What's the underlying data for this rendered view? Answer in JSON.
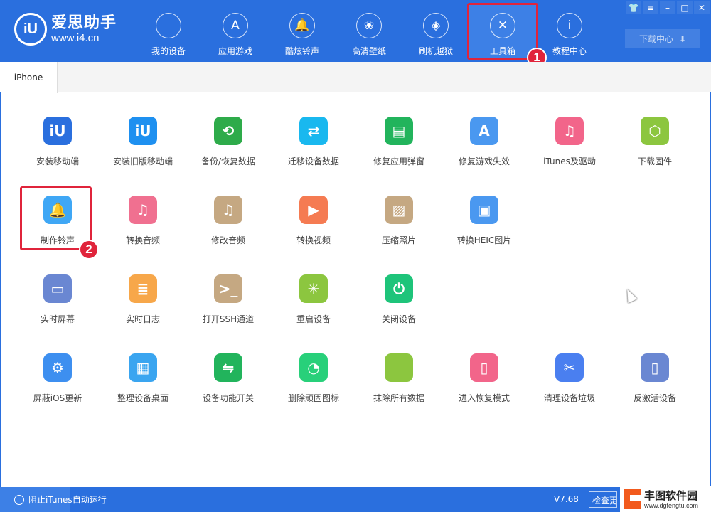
{
  "app": {
    "logo_mark": "iU",
    "name": "爱思助手",
    "url": "www.i4.cn"
  },
  "nav": [
    {
      "label": "我的设备",
      "icon": "apple-icon",
      "glyph": ""
    },
    {
      "label": "应用游戏",
      "icon": "app-store-icon",
      "glyph": "A"
    },
    {
      "label": "酷炫铃声",
      "icon": "bell-icon",
      "glyph": "🔔"
    },
    {
      "label": "高清壁纸",
      "icon": "flower-icon",
      "glyph": "❀"
    },
    {
      "label": "刷机越狱",
      "icon": "dropbox-icon",
      "glyph": "◈"
    },
    {
      "label": "工具箱",
      "icon": "tools-icon",
      "glyph": "✕",
      "active": true
    },
    {
      "label": "教程中心",
      "icon": "info-icon",
      "glyph": "i"
    }
  ],
  "window_controls": [
    "shirt-icon",
    "menu-icon",
    "minimize-icon",
    "maximize-icon",
    "close-icon"
  ],
  "window_glyphs": [
    "👕",
    "≡",
    "–",
    "□",
    "✕"
  ],
  "download_center": {
    "label": "下载中心",
    "icon": "download-icon"
  },
  "tabs": [
    {
      "label": "iPhone"
    }
  ],
  "badges": {
    "one": "1",
    "two": "2"
  },
  "rows": [
    [
      {
        "label": "安装移动端",
        "color": "#2a6fde",
        "glyph": "iU"
      },
      {
        "label": "安装旧版移动端",
        "color": "#1e90f0",
        "glyph": "iU"
      },
      {
        "label": "备份/恢复数据",
        "color": "#2eab4a",
        "glyph": "⟲"
      },
      {
        "label": "迁移设备数据",
        "color": "#19b8ef",
        "glyph": "⇄"
      },
      {
        "label": "修复应用弹窗",
        "color": "#22b45c",
        "glyph": "▤"
      },
      {
        "label": "修复游戏失效",
        "color": "#4a98f0",
        "glyph": "A"
      },
      {
        "label": "iTunes及驱动",
        "color": "#f2658a",
        "glyph": "♫"
      },
      {
        "label": "下载固件",
        "color": "#8cc63f",
        "glyph": "⬡"
      }
    ],
    [
      {
        "label": "制作铃声",
        "color": "#3fa7f5",
        "glyph": "🔔"
      },
      {
        "label": "转换音频",
        "color": "#f07090",
        "glyph": "♫"
      },
      {
        "label": "修改音频",
        "color": "#c5a882",
        "glyph": "♫"
      },
      {
        "label": "转换视频",
        "color": "#f57b52",
        "glyph": "▶"
      },
      {
        "label": "压缩照片",
        "color": "#c5a882",
        "glyph": "▨"
      },
      {
        "label": "转换HEIC图片",
        "color": "#4a98f0",
        "glyph": "▣"
      }
    ],
    [
      {
        "label": "实时屏幕",
        "color": "#6a87d2",
        "glyph": "▭"
      },
      {
        "label": "实时日志",
        "color": "#f7a74a",
        "glyph": "≣"
      },
      {
        "label": "打开SSH通道",
        "color": "#c5a882",
        "glyph": ">_"
      },
      {
        "label": "重启设备",
        "color": "#8cc63f",
        "glyph": "✳"
      },
      {
        "label": "关闭设备",
        "color": "#1ec47a",
        "glyph": "⏻"
      }
    ],
    [
      {
        "label": "屏蔽iOS更新",
        "color": "#3d8ff0",
        "glyph": "⚙"
      },
      {
        "label": "整理设备桌面",
        "color": "#3aa5f0",
        "glyph": "▦"
      },
      {
        "label": "设备功能开关",
        "color": "#22b45c",
        "glyph": "⇋"
      },
      {
        "label": "删除顽固图标",
        "color": "#28d07a",
        "glyph": "◔"
      },
      {
        "label": "抹除所有数据",
        "color": "#8cc63f",
        "glyph": ""
      },
      {
        "label": "进入恢复模式",
        "color": "#f2658a",
        "glyph": "▯"
      },
      {
        "label": "清理设备垃圾",
        "color": "#4a7ff0",
        "glyph": "✂"
      },
      {
        "label": "反激活设备",
        "color": "#6a87d2",
        "glyph": "▯"
      }
    ]
  ],
  "status": {
    "itunes_label": "阻止iTunes自动运行",
    "version": "V7.68",
    "check_update": "检查更新"
  },
  "watermark": {
    "name": "丰图软件园",
    "url": "www.dgfengtu.com"
  }
}
